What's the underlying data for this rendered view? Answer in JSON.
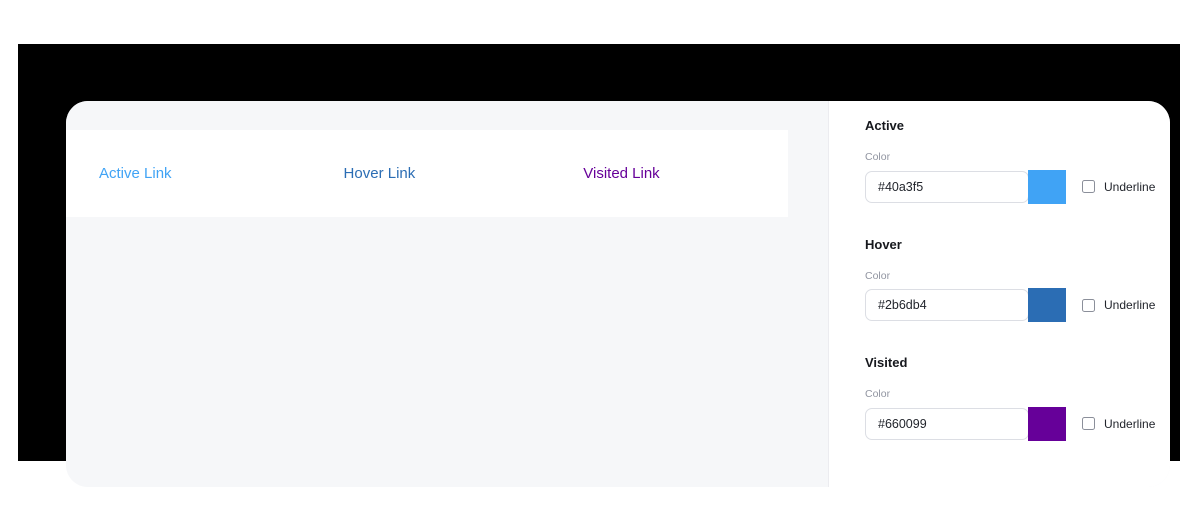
{
  "preview": {
    "links": [
      {
        "label": "Active Link",
        "color": "#40a3f5",
        "underline": false
      },
      {
        "label": "Hover Link",
        "color": "#2b6db4",
        "underline": false
      },
      {
        "label": "Visited Link",
        "color": "#660099",
        "underline": false
      }
    ]
  },
  "settings": {
    "groups": [
      {
        "title": "Active",
        "color_label": "Color",
        "color_value": "#40a3f5",
        "color_placeholder": "#000000",
        "swatch": "#40a3f5",
        "underline_label": "Underline",
        "underline_checked": false
      },
      {
        "title": "Hover",
        "color_label": "Color",
        "color_value": "#2b6db4",
        "color_placeholder": "#000000",
        "swatch": "#2b6db4",
        "underline_label": "Underline",
        "underline_checked": false
      },
      {
        "title": "Visited",
        "color_label": "Color",
        "color_value": "#660099",
        "color_placeholder": "#000000",
        "swatch": "#660099",
        "underline_label": "Underline",
        "underline_checked": false
      }
    ]
  }
}
